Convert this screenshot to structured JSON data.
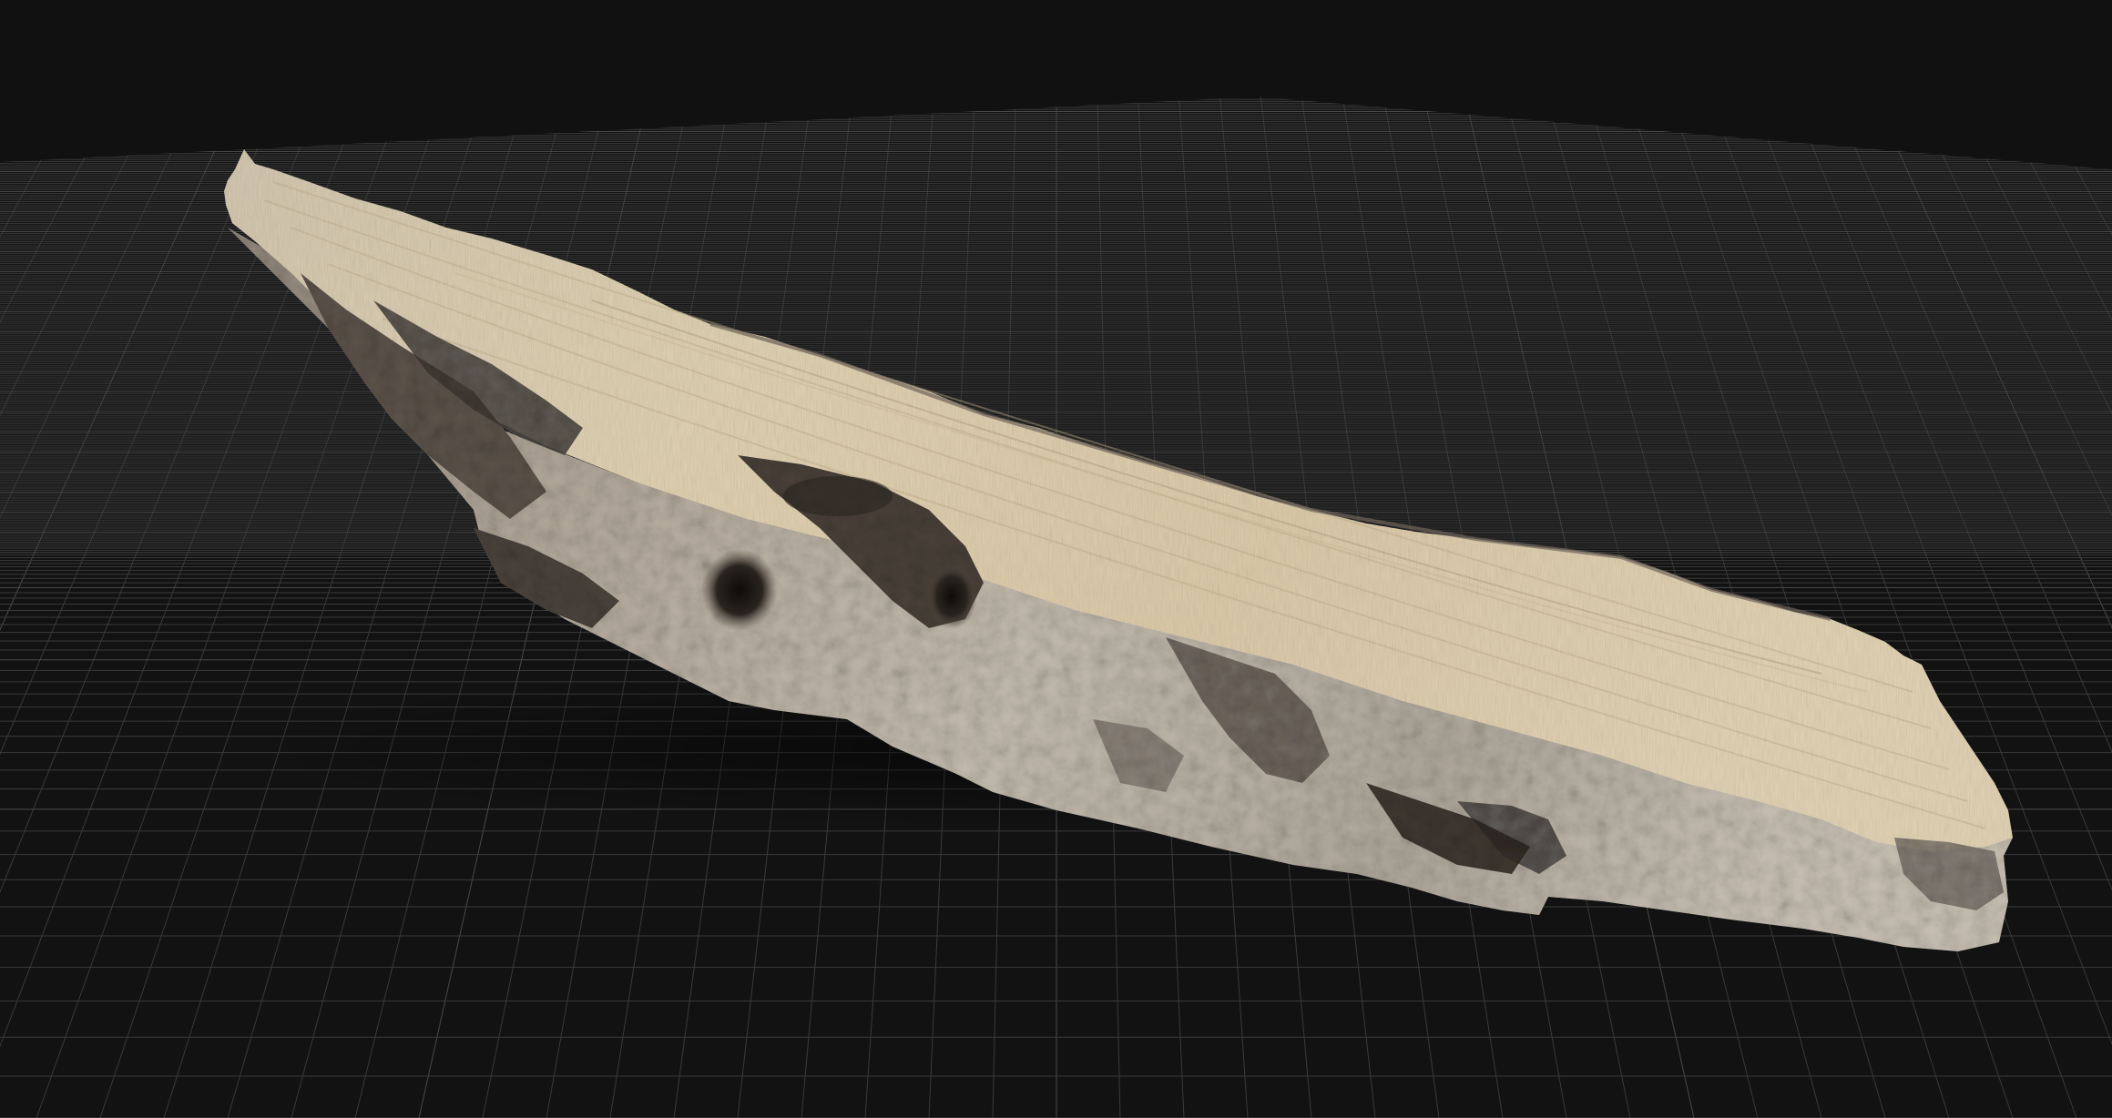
{
  "viewport": {
    "background_color": "#111111",
    "grid_floor_color": "#121212",
    "grid_line_color": "#3a3a3a",
    "grid_major_line_color": "#4a4a4a"
  },
  "model": {
    "subject": "driftwood-log-scan",
    "wood_light_color": "#d9c8a6",
    "wood_mid_color": "#b7ab98",
    "wood_dark_color": "#4a4038",
    "bark_color": "#6b6259"
  }
}
